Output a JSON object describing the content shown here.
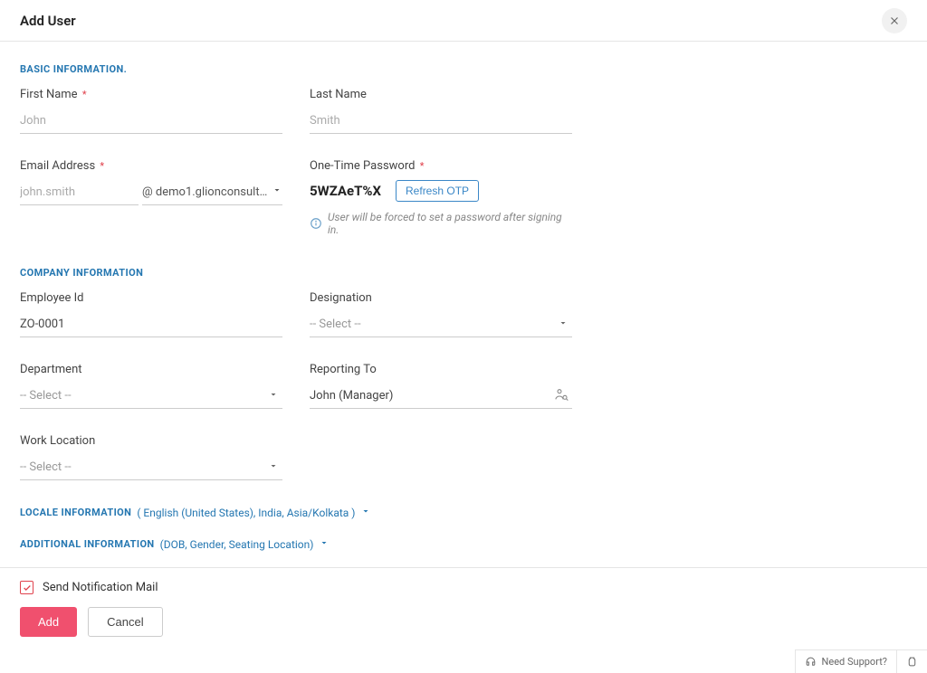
{
  "header": {
    "title": "Add User"
  },
  "basic": {
    "heading": "BASIC INFORMATION.",
    "first_name_label": "First Name",
    "first_name_value": "",
    "first_name_placeholder": "John",
    "last_name_label": "Last Name",
    "last_name_value": "",
    "last_name_placeholder": "Smith",
    "email_label": "Email Address",
    "email_value": "",
    "email_placeholder": "john.smith",
    "email_domain": "@ demo1.glionconsulti...",
    "otp_label": "One-Time Password",
    "otp_value": "5WZAeT%X",
    "refresh_label": "Refresh OTP",
    "otp_hint": "User will be forced to set a password after signing in."
  },
  "company": {
    "heading": "COMPANY INFORMATION",
    "employee_id_label": "Employee Id",
    "employee_id_value": "ZO-0001",
    "designation_label": "Designation",
    "designation_value": "-- Select --",
    "department_label": "Department",
    "department_value": "-- Select --",
    "reporting_label": "Reporting To",
    "reporting_value": "John (Manager)",
    "work_location_label": "Work Location",
    "work_location_value": "-- Select --"
  },
  "locale": {
    "heading": "LOCALE INFORMATION",
    "summary": "( English (United States), India, Asia/Kolkata )"
  },
  "additional": {
    "heading": "ADDITIONAL INFORMATION",
    "summary": "(DOB, Gender, Seating Location)"
  },
  "footer": {
    "notification_label": "Send Notification Mail",
    "notification_checked": true,
    "add_label": "Add",
    "cancel_label": "Cancel"
  },
  "support": {
    "label": "Need Support?"
  }
}
